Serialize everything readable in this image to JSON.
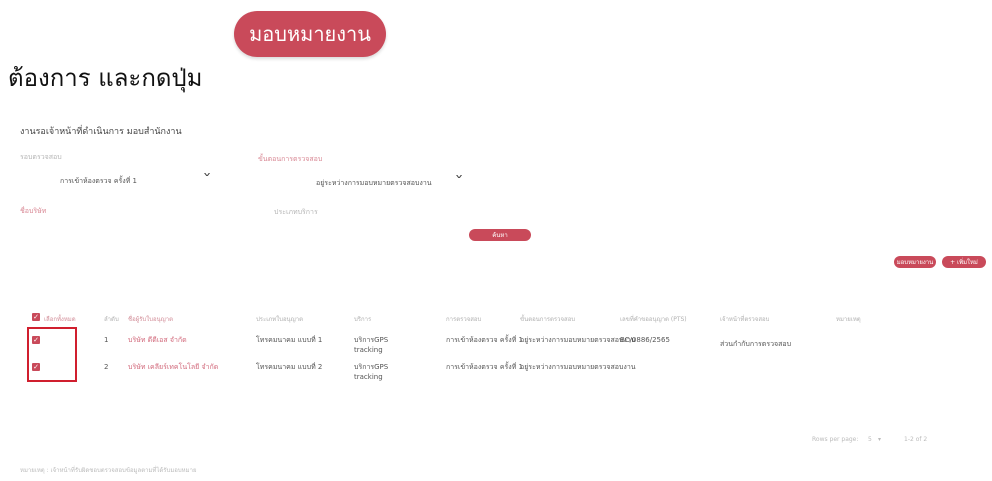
{
  "instruction": "ต้องการ และกดปุ่ม",
  "assign_button": "มอบหมายงาน",
  "page_title": "งานรอเจ้าหน้าที่ดำเนินการ มอบสำนักงาน",
  "filters": {
    "label1": "รอบตรวจสอบ",
    "label2": "ขั้นตอนการตรวจสอบ",
    "value1": "การเข้าห้องตรวจ ครั้งที่ 1",
    "value2": "อยู่ระหว่างการมอบหมายตรวจสอบงาน",
    "label3": "ชื่อบริษัท",
    "label4": "ประเภทบริการ"
  },
  "search_button": "ค้นหา",
  "actions": {
    "assign_small": "มอบหมายงาน",
    "add": "+ เพิ่มใหม่"
  },
  "table": {
    "headers": [
      "เลือกทั้งหมด",
      "ลำดับ",
      "ชื่อผู้รับใบอนุญาต",
      "ประเภทใบอนุญาต",
      "บริการ",
      "การตรวจสอบ",
      "ขั้นตอนการตรวจสอบ",
      "เลขที่คำขออนุญาต (PTS)",
      "เจ้าหน้าที่ตรวจสอบ",
      "หมายเหตุ"
    ],
    "rows": [
      {
        "no": "1",
        "company": "บริษัท ดีดีเอส จำกัด",
        "license": "โทรคมนาคม แบบที่ 1",
        "service": "บริการGPS tracking",
        "round": "การเข้าห้องตรวจ ครั้งที่ 1",
        "status": "อยู่ระหว่างการมอบหมายตรวจสอบงาน",
        "ref": "BC/0886/2565",
        "officer": "ส่วนกำกับการตรวจสอบ"
      },
      {
        "no": "2",
        "company": "บริษัท เคลียร์เทคโนโลยี จำกัด",
        "license": "โทรคมนาคม แบบที่ 2",
        "service": "บริการGPS tracking",
        "round": "การเข้าห้องตรวจ ครั้งที่ 1",
        "status": "อยู่ระหว่างการมอบหมายตรวจสอบงาน",
        "ref": "",
        "officer": ""
      }
    ]
  },
  "pagination": {
    "rows_per_page_label": "Rows per page:",
    "rows_per_page_value": "5",
    "range": "1-2 of 2"
  },
  "footer_note": "หมายเหตุ : เจ้าหน้าที่รับผิดชอบตรวจสอบข้อมูลตามที่ได้รับมอบหมาย",
  "colors": {
    "accent": "#c94a5a",
    "highlight": "#d01f2e"
  }
}
